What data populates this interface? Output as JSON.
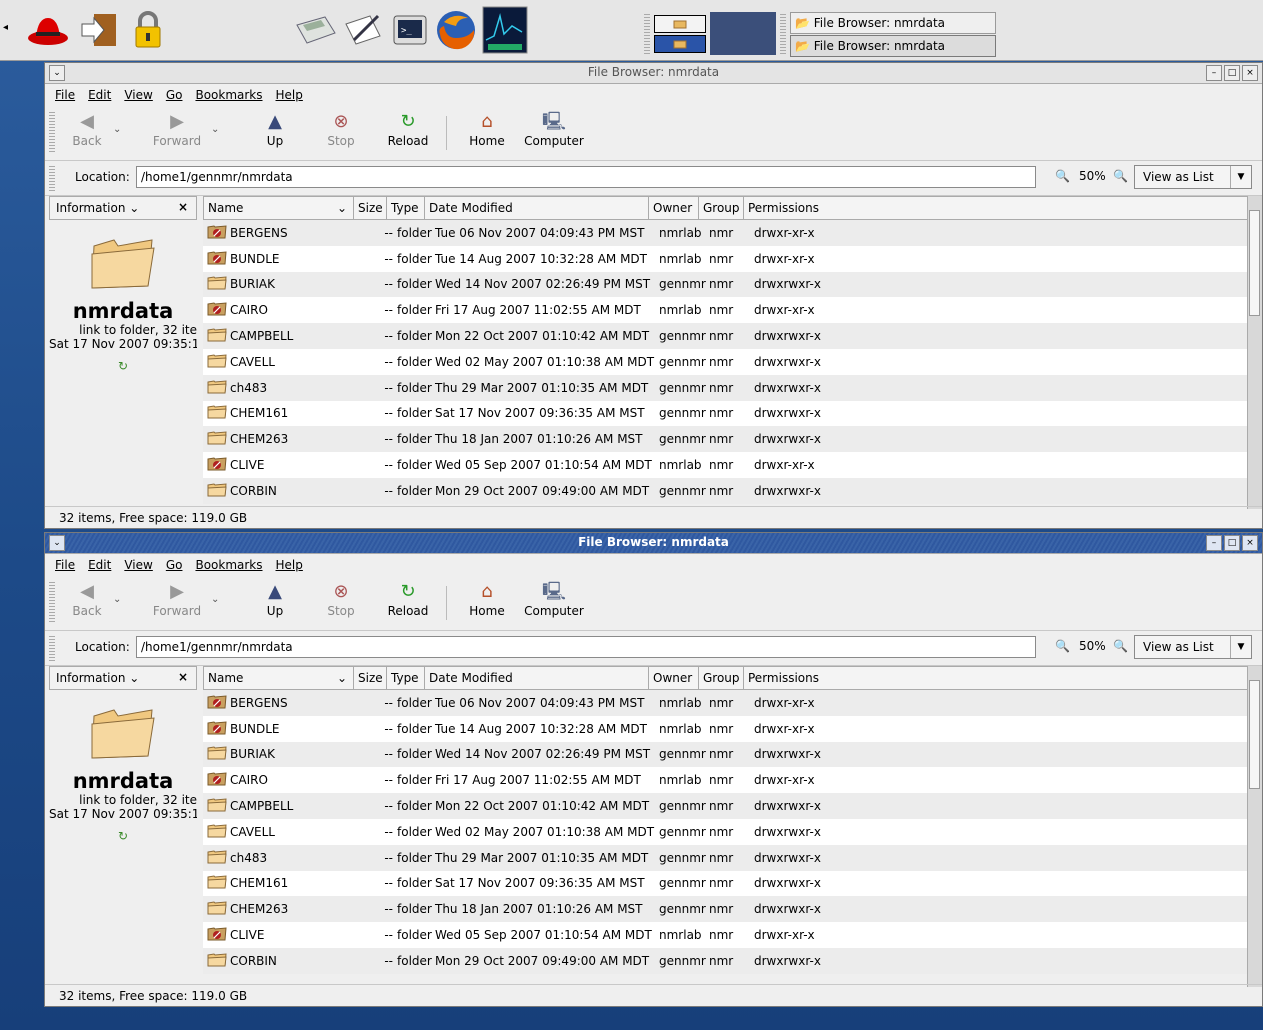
{
  "panel": {
    "tasks": [
      {
        "label": "File Browser: nmrdata",
        "active": false
      },
      {
        "label": "File Browser: nmrdata",
        "active": true
      }
    ]
  },
  "window": {
    "title": "File Browser: nmrdata",
    "menu": [
      "File",
      "Edit",
      "View",
      "Go",
      "Bookmarks",
      "Help"
    ],
    "toolbar": {
      "back": "Back",
      "forward": "Forward",
      "up": "Up",
      "stop": "Stop",
      "reload": "Reload",
      "home": "Home",
      "computer": "Computer"
    },
    "location_label": "Location:",
    "location": "/home1/gennmr/nmrdata",
    "zoom": "50%",
    "view_as": "View as List",
    "sidebar": {
      "dropdown": "Information",
      "close": "×",
      "folder_name": "nmrdata",
      "subtitle": "link to folder, 32 ite",
      "date": "Sat 17 Nov 2007 09:35:1"
    },
    "columns": [
      "Name",
      "Size",
      "Type",
      "Date Modified",
      "Owner",
      "Group",
      "Permissions"
    ],
    "rows": [
      {
        "name": "BERGENS",
        "size": "--",
        "type": "folder",
        "date": "Tue 06 Nov 2007 04:09:43 PM MST",
        "owner": "nmrlab",
        "group": "nmr",
        "perm": "drwxr-xr-x",
        "locked": true
      },
      {
        "name": "BUNDLE",
        "size": "--",
        "type": "folder",
        "date": "Tue 14 Aug 2007 10:32:28 AM MDT",
        "owner": "nmrlab",
        "group": "nmr",
        "perm": "drwxr-xr-x",
        "locked": true
      },
      {
        "name": "BURIAK",
        "size": "--",
        "type": "folder",
        "date": "Wed 14 Nov 2007 02:26:49 PM MST",
        "owner": "gennmr",
        "group": "nmr",
        "perm": "drwxrwxr-x",
        "locked": false
      },
      {
        "name": "CAIRO",
        "size": "--",
        "type": "folder",
        "date": "Fri 17 Aug 2007 11:02:55 AM MDT",
        "owner": "nmrlab",
        "group": "nmr",
        "perm": "drwxr-xr-x",
        "locked": true
      },
      {
        "name": "CAMPBELL",
        "size": "--",
        "type": "folder",
        "date": "Mon 22 Oct 2007 01:10:42 AM MDT",
        "owner": "gennmr",
        "group": "nmr",
        "perm": "drwxrwxr-x",
        "locked": false
      },
      {
        "name": "CAVELL",
        "size": "--",
        "type": "folder",
        "date": "Wed 02 May 2007 01:10:38 AM MDT",
        "owner": "gennmr",
        "group": "nmr",
        "perm": "drwxrwxr-x",
        "locked": false
      },
      {
        "name": "ch483",
        "size": "--",
        "type": "folder",
        "date": "Thu 29 Mar 2007 01:10:35 AM MDT",
        "owner": "gennmr",
        "group": "nmr",
        "perm": "drwxrwxr-x",
        "locked": false
      },
      {
        "name": "CHEM161",
        "size": "--",
        "type": "folder",
        "date": "Sat 17 Nov 2007 09:36:35 AM MST",
        "owner": "gennmr",
        "group": "nmr",
        "perm": "drwxrwxr-x",
        "locked": false
      },
      {
        "name": "CHEM263",
        "size": "--",
        "type": "folder",
        "date": "Thu 18 Jan 2007 01:10:26 AM MST",
        "owner": "gennmr",
        "group": "nmr",
        "perm": "drwxrwxr-x",
        "locked": false
      },
      {
        "name": "CLIVE",
        "size": "--",
        "type": "folder",
        "date": "Wed 05 Sep 2007 01:10:54 AM MDT",
        "owner": "nmrlab",
        "group": "nmr",
        "perm": "drwxr-xr-x",
        "locked": true
      },
      {
        "name": "CORBIN",
        "size": "--",
        "type": "folder",
        "date": "Mon 29 Oct 2007 09:49:00 AM MDT",
        "owner": "gennmr",
        "group": "nmr",
        "perm": "drwxrwxr-x",
        "locked": false
      }
    ],
    "status": "32 items, Free space: 119.0 GB"
  }
}
